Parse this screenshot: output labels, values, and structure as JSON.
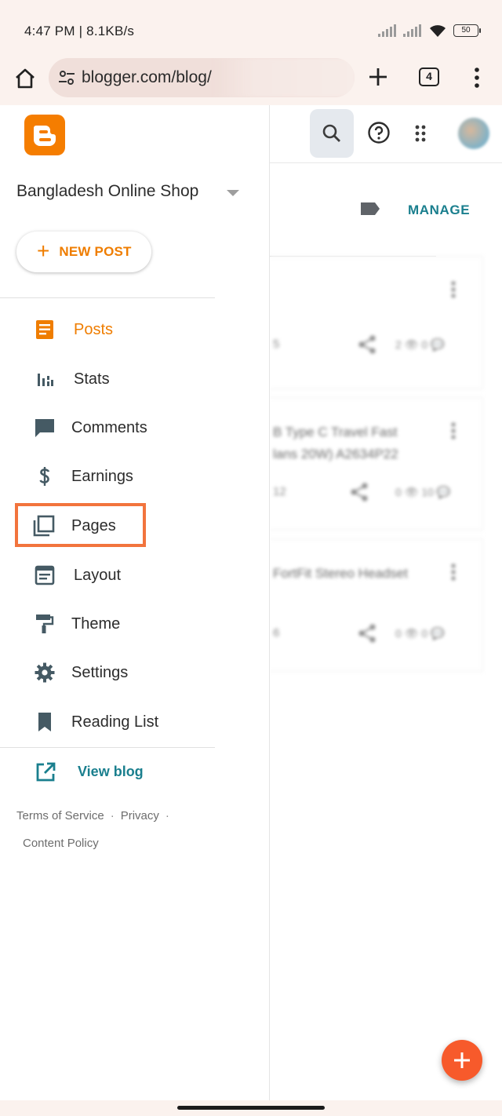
{
  "status_bar": {
    "time": "4:47 PM | 8.1KB/s",
    "battery": "50"
  },
  "browser": {
    "url": "blogger.com/blog/",
    "tab_count": "4"
  },
  "background_app": {
    "manage_label": "MANAGE",
    "posts": [
      {
        "title": "",
        "meta": "5",
        "stats": "2 👁  0 💬"
      },
      {
        "title": "B Type C Travel Fast",
        "subtitle": "lans 20W) A2634P22",
        "meta": "12",
        "stats": "0 👁  10 💬"
      },
      {
        "title": "FortFit Stereo Headset",
        "meta": "6",
        "stats": "0 👁  0 💬"
      }
    ]
  },
  "drawer": {
    "blog_name": "Bangladesh Online Shop",
    "new_post_label": "NEW POST",
    "nav": {
      "posts": "Posts",
      "stats": "Stats",
      "comments": "Comments",
      "earnings": "Earnings",
      "pages": "Pages",
      "layout": "Layout",
      "theme": "Theme",
      "settings": "Settings",
      "reading_list": "Reading List"
    },
    "view_blog": "View blog",
    "footer": {
      "terms": "Terms of Service",
      "privacy": "Privacy",
      "content_policy": "Content Policy",
      "dot": "·"
    }
  },
  "colors": {
    "accent_orange": "#ef7d00",
    "teal_link": "#1a7f8e",
    "highlight": "#f2743d",
    "fab": "#f75a2b"
  }
}
